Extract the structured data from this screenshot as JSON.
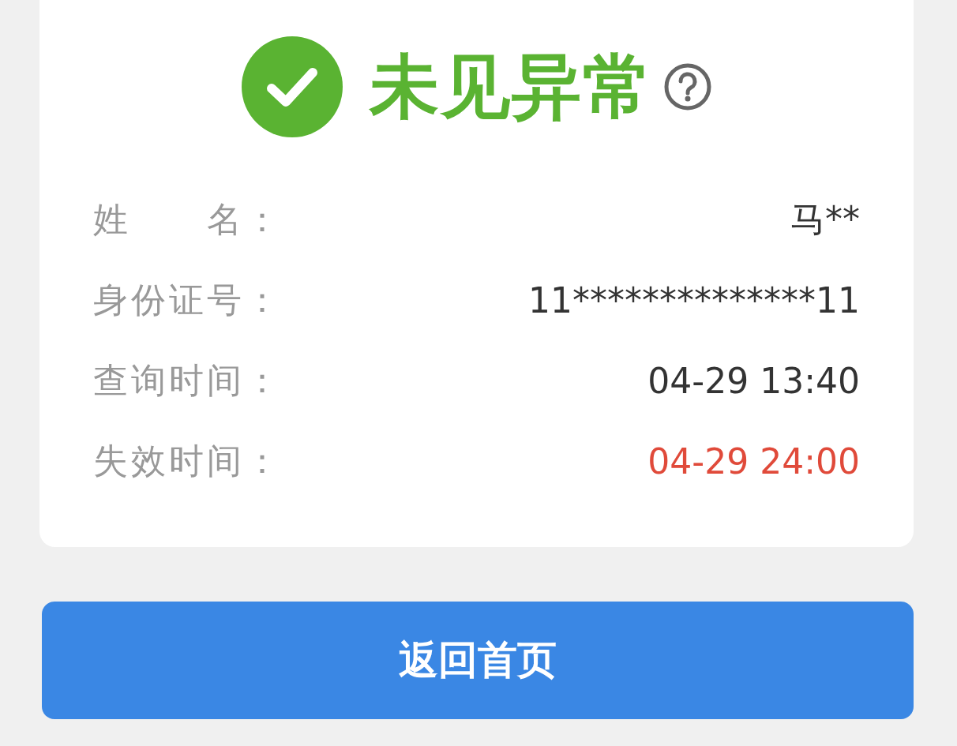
{
  "status": {
    "label": "未见异常",
    "help": true
  },
  "fields": [
    {
      "label": "姓　　名：",
      "value": "马**",
      "color": "#333333"
    },
    {
      "label": "身份证号：",
      "value": "11**************11",
      "color": "#333333"
    },
    {
      "label": "查询时间：",
      "value": "04-29 13:40",
      "color": "#333333"
    },
    {
      "label": "失效时间：",
      "value": "04-29 24:00",
      "color": "#e04a3a"
    }
  ],
  "button": {
    "label": "返回首页"
  }
}
